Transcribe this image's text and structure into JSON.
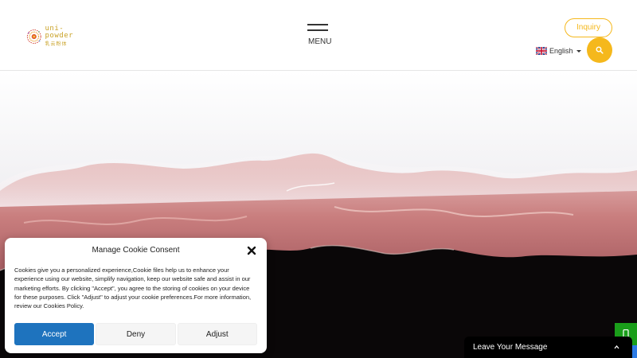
{
  "header": {
    "logo": {
      "text_en": "uni-powder",
      "text_cn": "乳云粉体",
      "accent": "#c9a227"
    },
    "menu_label": "MENU",
    "inquiry_label": "Inquiry",
    "language": {
      "label": "English",
      "icon": "uk-flag-icon"
    },
    "search_icon": "search-icon",
    "accent_color": "#f5b81c"
  },
  "cookie": {
    "title": "Manage Cookie Consent",
    "body": "Cookies give you a personalized experience,Cookie files help us to enhance your experience using our website, simplify navigation, keep our website safe and assist in our marketing efforts. By clicking \"Accept\", you agree to the storing of cookies on your device for these purposes. Click \"Adjust\" to adjust your cookie preferences.For more information, review our Cookies Policy.",
    "accept_label": "Accept",
    "deny_label": "Deny",
    "adjust_label": "Adjust",
    "accept_color": "#1e73be"
  },
  "chat": {
    "label": "Leave Your Message"
  }
}
